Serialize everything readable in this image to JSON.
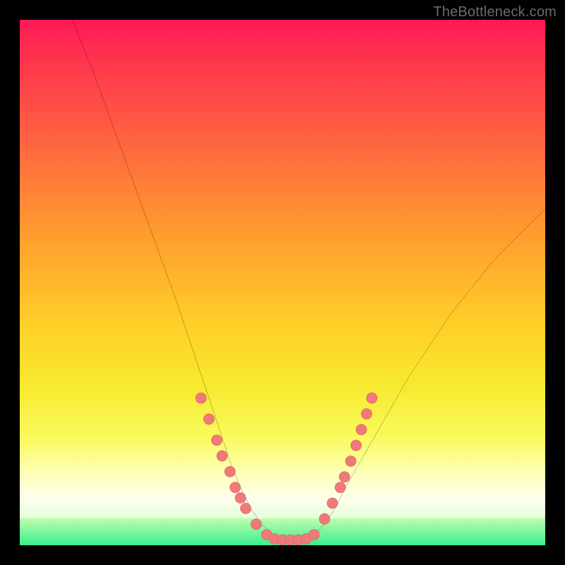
{
  "watermark": "TheBottleneck.com",
  "colors": {
    "page_bg": "#000000",
    "curve": "#000000",
    "marker_fill": "#f07a7a",
    "marker_stroke": "#e06868",
    "gradient_stops": [
      "#ff1a55",
      "#ff6a3f",
      "#ffcf28",
      "#f9f95a",
      "#ffffe6",
      "#39ef8a"
    ]
  },
  "chart_data": {
    "type": "line",
    "title": "",
    "xlabel": "",
    "ylabel": "",
    "xlim": [
      0,
      100
    ],
    "ylim": [
      0,
      100
    ],
    "grid": false,
    "legend": null,
    "series": [
      {
        "name": "bottleneck-curve",
        "x": [
          10,
          14,
          18,
          22,
          26,
          30,
          32,
          34,
          36,
          38,
          40,
          42,
          44,
          46,
          48,
          50,
          52,
          54,
          56,
          58,
          60,
          62,
          66,
          70,
          74,
          78,
          82,
          86,
          90,
          94,
          98,
          100
        ],
        "y": [
          100,
          90,
          79,
          68,
          57,
          46,
          40,
          34,
          28,
          22,
          16,
          11,
          7,
          4,
          2,
          1,
          1,
          1,
          2,
          4,
          7,
          11,
          18,
          25,
          32,
          38,
          44,
          49,
          54,
          58,
          62,
          64
        ]
      }
    ],
    "markers": [
      {
        "x": 34.5,
        "y": 28
      },
      {
        "x": 36.0,
        "y": 24
      },
      {
        "x": 37.5,
        "y": 20
      },
      {
        "x": 38.5,
        "y": 17
      },
      {
        "x": 40.0,
        "y": 14
      },
      {
        "x": 41.0,
        "y": 11
      },
      {
        "x": 42.0,
        "y": 9
      },
      {
        "x": 43.0,
        "y": 7
      },
      {
        "x": 45.0,
        "y": 4
      },
      {
        "x": 47.0,
        "y": 2
      },
      {
        "x": 48.5,
        "y": 1.2
      },
      {
        "x": 50.0,
        "y": 1
      },
      {
        "x": 51.5,
        "y": 1
      },
      {
        "x": 53.0,
        "y": 1
      },
      {
        "x": 54.5,
        "y": 1.2
      },
      {
        "x": 56.0,
        "y": 2
      },
      {
        "x": 58.0,
        "y": 5
      },
      {
        "x": 59.5,
        "y": 8
      },
      {
        "x": 61.0,
        "y": 11
      },
      {
        "x": 61.8,
        "y": 13
      },
      {
        "x": 63.0,
        "y": 16
      },
      {
        "x": 64.0,
        "y": 19
      },
      {
        "x": 65.0,
        "y": 22
      },
      {
        "x": 66.0,
        "y": 25
      },
      {
        "x": 67.0,
        "y": 28
      }
    ],
    "marker_radius": 1.0
  }
}
